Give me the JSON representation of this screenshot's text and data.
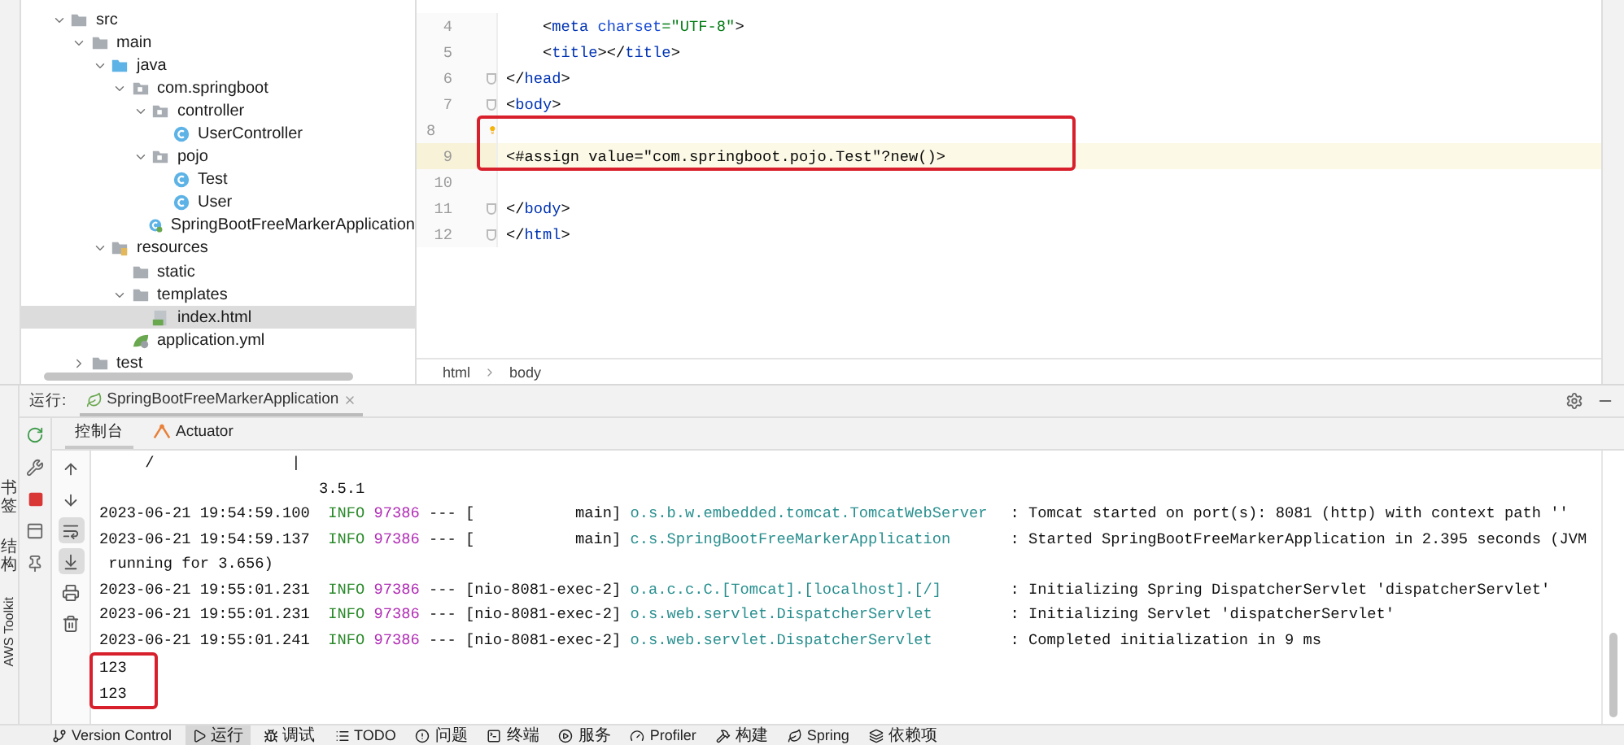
{
  "project_tree": [
    {
      "label": "src",
      "kind": "folder",
      "expanded": true,
      "selected": false,
      "children": [
        {
          "label": "main",
          "kind": "folder",
          "expanded": true,
          "selected": false,
          "children": [
            {
              "label": "java",
              "kind": "source_root",
              "expanded": true,
              "selected": false,
              "children": [
                {
                  "label": "com.springboot",
                  "kind": "package",
                  "expanded": true,
                  "selected": false,
                  "children": [
                    {
                      "label": "controller",
                      "kind": "package",
                      "expanded": true,
                      "selected": false,
                      "children": [
                        {
                          "label": "UserController",
                          "kind": "class",
                          "selected": false
                        }
                      ]
                    },
                    {
                      "label": "pojo",
                      "kind": "package",
                      "expanded": true,
                      "selected": false,
                      "children": [
                        {
                          "label": "Test",
                          "kind": "class",
                          "selected": false
                        },
                        {
                          "label": "User",
                          "kind": "class",
                          "selected": false
                        }
                      ]
                    },
                    {
                      "label": "SpringBootFreeMarkerApplication",
                      "kind": "main_class",
                      "selected": false
                    }
                  ]
                }
              ]
            },
            {
              "label": "resources",
              "kind": "resource_root",
              "expanded": true,
              "selected": false,
              "children": [
                {
                  "label": "static",
                  "kind": "folder",
                  "selected": false
                },
                {
                  "label": "templates",
                  "kind": "folder",
                  "expanded": true,
                  "selected": false,
                  "children": [
                    {
                      "label": "index.html",
                      "kind": "html",
                      "selected": true
                    }
                  ]
                },
                {
                  "label": "application.yml",
                  "kind": "yml",
                  "selected": false
                }
              ]
            }
          ]
        },
        {
          "label": "test",
          "kind": "folder",
          "expanded": false,
          "selected": false
        }
      ]
    }
  ],
  "editor": {
    "lines": [
      {
        "number": "4",
        "fold": false,
        "marked": false,
        "current": false,
        "segments": [
          {
            "kind": "plain",
            "text": "    <"
          },
          {
            "kind": "tag",
            "text": "meta"
          },
          {
            "kind": "attr",
            "text": " charset"
          },
          {
            "kind": "string",
            "text": "=\"UTF-8\""
          },
          {
            "kind": "plain",
            "text": ">"
          }
        ]
      },
      {
        "number": "5",
        "fold": false,
        "marked": false,
        "current": false,
        "segments": [
          {
            "kind": "plain",
            "text": "    <"
          },
          {
            "kind": "tag",
            "text": "title"
          },
          {
            "kind": "plain",
            "text": "></"
          },
          {
            "kind": "tag",
            "text": "title"
          },
          {
            "kind": "plain",
            "text": ">"
          }
        ]
      },
      {
        "number": "6",
        "fold": true,
        "marked": false,
        "current": false,
        "segments": [
          {
            "kind": "plain",
            "text": "</"
          },
          {
            "kind": "tag",
            "text": "head"
          },
          {
            "kind": "plain",
            "text": ">"
          }
        ]
      },
      {
        "number": "7",
        "fold": true,
        "marked": false,
        "current": false,
        "segments": [
          {
            "kind": "plain",
            "text": "<"
          },
          {
            "kind": "tag",
            "text": "body"
          },
          {
            "kind": "plain",
            "text": ">"
          }
        ]
      },
      {
        "number": "8",
        "fold": false,
        "marked": true,
        "current": false,
        "bulb": true
      },
      {
        "number": "9",
        "fold": false,
        "marked": true,
        "current": true,
        "segments": [
          {
            "kind": "plain",
            "text": "<#assign value=\"com.springboot.pojo.Test\"?new()>"
          }
        ]
      },
      {
        "number": "10",
        "fold": false,
        "marked": false,
        "current": false
      },
      {
        "number": "11",
        "fold": true,
        "marked": false,
        "current": false,
        "segments": [
          {
            "kind": "plain",
            "text": "</"
          },
          {
            "kind": "tag",
            "text": "body"
          },
          {
            "kind": "plain",
            "text": ">"
          }
        ]
      },
      {
        "number": "12",
        "fold": true,
        "marked": false,
        "current": false,
        "segments": [
          {
            "kind": "plain",
            "text": "</"
          },
          {
            "kind": "tag",
            "text": "html"
          },
          {
            "kind": "plain",
            "text": ">"
          }
        ]
      }
    ],
    "breadcrumbs": [
      "html",
      "body"
    ]
  },
  "left_strip": [
    {
      "kind": "cjk",
      "label": "书签"
    },
    {
      "kind": "cjk",
      "label": "结构"
    },
    {
      "kind": "latin",
      "label": "AWS Toolkit"
    }
  ],
  "run_panel": {
    "label": "运行:",
    "tab": "SpringBootFreeMarkerApplication",
    "tabs": [
      {
        "label": "控制台",
        "selected": true
      },
      {
        "label": "Actuator",
        "selected": false
      }
    ],
    "console_toolbar": [
      {
        "on": false
      },
      {
        "on": false
      },
      {
        "on": true
      },
      {
        "on": true
      },
      {
        "on": false
      },
      {
        "on": false
      }
    ],
    "console": [
      {
        "kind": "plain",
        "marked": false,
        "text": "     /               |"
      },
      {
        "kind": "plain",
        "marked": false,
        "text": "                        3.5.1"
      },
      {
        "kind": "log",
        "marked": false,
        "time": "2023-06-21 19:54:59.100",
        "level": "INFO",
        "pid": "97386",
        "sep": "---",
        "thread": "[           main]",
        "logger": "o.s.b.w.embedded.tomcat.TomcatWebServer",
        "message": ": Tomcat started on port(s): 8081 (http) with context path ''"
      },
      {
        "kind": "log",
        "marked": false,
        "time": "2023-06-21 19:54:59.137",
        "level": "INFO",
        "pid": "97386",
        "sep": "---",
        "thread": "[           main]",
        "logger": "c.s.SpringBootFreeMarkerApplication",
        "message": ": Started SpringBootFreeMarkerApplication in 2.395 seconds (JVM"
      },
      {
        "kind": "plain",
        "marked": false,
        "text": " running for 3.656)"
      },
      {
        "kind": "log",
        "marked": false,
        "time": "2023-06-21 19:55:01.231",
        "level": "INFO",
        "pid": "97386",
        "sep": "---",
        "thread": "[nio-8081-exec-2]",
        "logger": "o.a.c.c.C.[Tomcat].[localhost].[/]",
        "message": ": Initializing Spring DispatcherServlet 'dispatcherServlet'"
      },
      {
        "kind": "log",
        "marked": false,
        "time": "2023-06-21 19:55:01.231",
        "level": "INFO",
        "pid": "97386",
        "sep": "---",
        "thread": "[nio-8081-exec-2]",
        "logger": "o.s.web.servlet.DispatcherServlet",
        "message": ": Initializing Servlet 'dispatcherServlet'"
      },
      {
        "kind": "log",
        "marked": false,
        "time": "2023-06-21 19:55:01.241",
        "level": "INFO",
        "pid": "97386",
        "sep": "---",
        "thread": "[nio-8081-exec-2]",
        "logger": "o.s.web.servlet.DispatcherServlet",
        "message": ": Completed initialization in 9 ms"
      },
      {
        "kind": "plain",
        "marked": true,
        "text": "123"
      },
      {
        "kind": "plain",
        "marked": true,
        "text": "123"
      }
    ]
  },
  "tool_window_bar": [
    {
      "label": "Version Control",
      "selected": false
    },
    {
      "label": "运行",
      "selected": true
    },
    {
      "label": "调试",
      "selected": false
    },
    {
      "label": "TODO",
      "selected": false
    },
    {
      "label": "问题",
      "selected": false
    },
    {
      "label": "终端",
      "selected": false
    },
    {
      "label": "服务",
      "selected": false
    },
    {
      "label": "Profiler",
      "selected": false
    },
    {
      "label": "构建",
      "selected": false
    },
    {
      "label": "Spring",
      "selected": false
    },
    {
      "label": "依赖项",
      "selected": false
    }
  ]
}
